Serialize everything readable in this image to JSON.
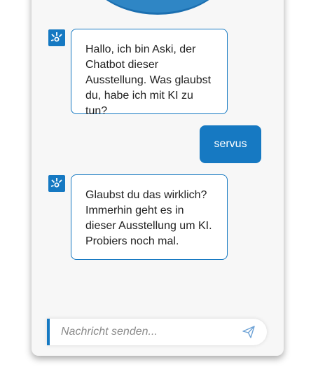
{
  "chat": {
    "messages": [
      {
        "sender": "bot",
        "text": "Hallo, ich bin Aski, der Chatbot dieser Ausstellung. Was glaubst du, habe ich mit KI zu tun?"
      },
      {
        "sender": "user",
        "text": "servus"
      },
      {
        "sender": "bot",
        "text": "Glaubst du das wirklich? Immerhin geht es in dieser Ausstellung um KI. Probiers noch mal."
      }
    ]
  },
  "composer": {
    "placeholder": "Nachricht senden...",
    "value": ""
  },
  "icons": {
    "avatar": "bot-logo-icon",
    "send": "paper-plane-icon"
  },
  "colors": {
    "accent": "#1679c2",
    "header": "#2f86c5",
    "panel_bg": "#f7f7f7"
  }
}
